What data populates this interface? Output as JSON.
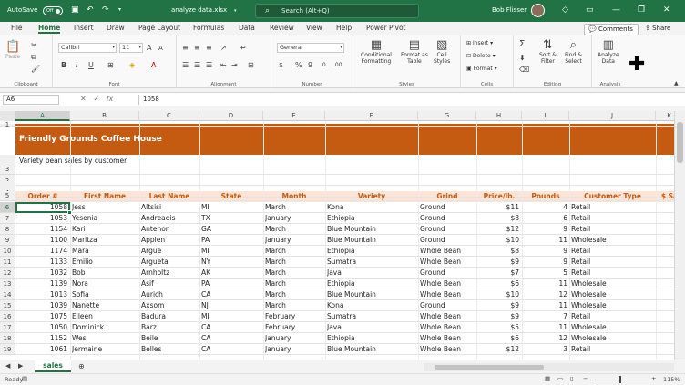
{
  "titlebar": {
    "autosave_label": "AutoSave",
    "autosave_state": "Off",
    "filename": "analyze data.xlsx",
    "search_placeholder": "Search (Alt+Q)",
    "user_name": "Bob Flisser"
  },
  "tabs": [
    "File",
    "Home",
    "Insert",
    "Draw",
    "Page Layout",
    "Formulas",
    "Data",
    "Review",
    "View",
    "Help",
    "Power Pivot"
  ],
  "active_tab": "Home",
  "comments_label": "Comments",
  "share_label": "Share",
  "ribbon": {
    "clipboard": {
      "paste": "Paste",
      "label": "Clipboard"
    },
    "font": {
      "name": "Calibri",
      "size": "11",
      "label": "Font"
    },
    "alignment": {
      "label": "Alignment"
    },
    "number": {
      "format": "General",
      "label": "Number"
    },
    "styles": {
      "conditional": "Conditional",
      "conditional2": "Formatting",
      "format_as": "Format as",
      "format_as2": "Table",
      "cell": "Cell",
      "cell2": "Styles",
      "label": "Styles"
    },
    "cells": {
      "insert": "Insert",
      "delete": "Delete",
      "format": "Format",
      "label": "Cells"
    },
    "editing": {
      "sort": "Sort &",
      "sort2": "Filter",
      "find": "Find &",
      "find2": "Select",
      "label": "Editing"
    },
    "analysis": {
      "analyze": "Analyze",
      "analyze2": "Data",
      "label": "Analysis"
    }
  },
  "formula_bar": {
    "name_box": "A6",
    "formula": "1058"
  },
  "columns": [
    "A",
    "B",
    "C",
    "D",
    "E",
    "F",
    "G",
    "H",
    "I",
    "J",
    "K"
  ],
  "sheet": {
    "title": "Friendly Grounds Coffee House",
    "subtitle": "Variety bean sales by customer",
    "headers": [
      "Order #",
      "First Name",
      "Last Name",
      "State",
      "Month",
      "Variety",
      "Grind",
      "Price/lb.",
      "Pounds",
      "Customer Type",
      "$ Sa"
    ],
    "rows": [
      [
        "1058",
        "Jess",
        "Altsisi",
        "MI",
        "March",
        "Kona",
        "Ground",
        "$11",
        "4",
        "Retail",
        ""
      ],
      [
        "1053",
        "Yesenia",
        "Andreadis",
        "TX",
        "January",
        "Ethiopia",
        "Ground",
        "$8",
        "6",
        "Retail",
        ""
      ],
      [
        "1154",
        "Kari",
        "Antenor",
        "GA",
        "March",
        "Blue Mountain",
        "Ground",
        "$12",
        "9",
        "Retail",
        "$"
      ],
      [
        "1100",
        "Maritza",
        "Applen",
        "PA",
        "January",
        "Blue Mountain",
        "Ground",
        "$10",
        "11",
        "Wholesale",
        "$"
      ],
      [
        "1174",
        "Mara",
        "Argue",
        "MI",
        "March",
        "Ethiopia",
        "Whole Bean",
        "$8",
        "9",
        "Retail",
        ""
      ],
      [
        "1133",
        "Emilio",
        "Argueta",
        "NY",
        "March",
        "Sumatra",
        "Whole Bean",
        "$9",
        "9",
        "Retail",
        ""
      ],
      [
        "1032",
        "Bob",
        "Arnholtz",
        "AK",
        "March",
        "Java",
        "Ground",
        "$7",
        "5",
        "Retail",
        ""
      ],
      [
        "1139",
        "Nora",
        "Asif",
        "PA",
        "March",
        "Ethiopia",
        "Whole Bean",
        "$6",
        "11",
        "Wholesale",
        ""
      ],
      [
        "1013",
        "Sofia",
        "Aurich",
        "CA",
        "March",
        "Blue Mountain",
        "Whole Bean",
        "$10",
        "12",
        "Wholesale",
        "$"
      ],
      [
        "1039",
        "Nanette",
        "Axsom",
        "NJ",
        "March",
        "Kona",
        "Ground",
        "$9",
        "11",
        "Wholesale",
        ""
      ],
      [
        "1075",
        "Eileen",
        "Badura",
        "MI",
        "February",
        "Sumatra",
        "Whole Bean",
        "$9",
        "7",
        "Retail",
        ""
      ],
      [
        "1050",
        "Dominick",
        "Barz",
        "CA",
        "February",
        "Java",
        "Whole Bean",
        "$5",
        "11",
        "Wholesale",
        ""
      ],
      [
        "1152",
        "Wes",
        "Beile",
        "CA",
        "January",
        "Ethiopia",
        "Whole Bean",
        "$6",
        "12",
        "Wholesale",
        ""
      ],
      [
        "1061",
        "Jermaine",
        "Belles",
        "CA",
        "January",
        "Blue Mountain",
        "Whole Bean",
        "$12",
        "3",
        "Retail",
        ""
      ]
    ]
  },
  "row_numbers": [
    "1",
    "2",
    "3",
    "4",
    "5",
    "6",
    "7",
    "8",
    "9",
    "10",
    "11",
    "12",
    "13",
    "14",
    "15",
    "16",
    "17",
    "18",
    "19"
  ],
  "sheet_tab": "sales",
  "status": {
    "ready": "Ready",
    "zoom": "115%"
  }
}
